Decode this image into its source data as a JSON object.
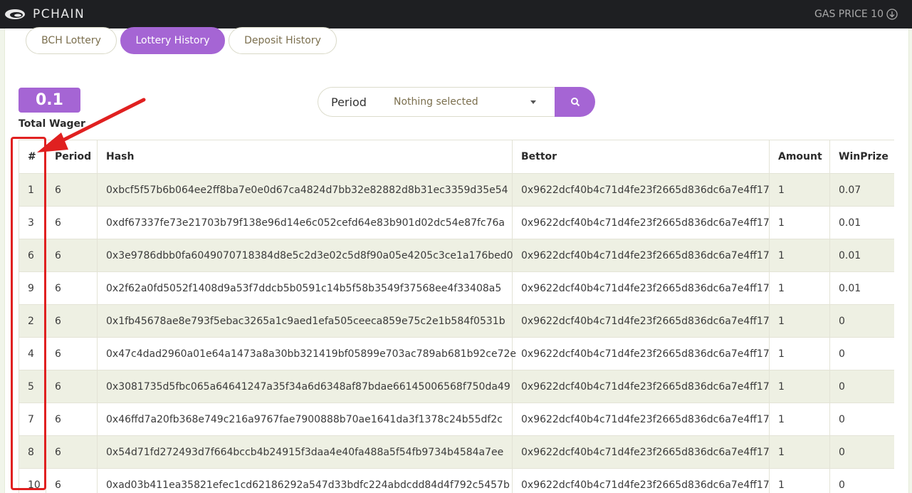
{
  "header": {
    "brand": "PCHAIN",
    "gas_label": "GAS PRICE 10"
  },
  "tabs": [
    {
      "label": "BCH Lottery",
      "active": false
    },
    {
      "label": "Lottery History",
      "active": true
    },
    {
      "label": "Deposit History",
      "active": false
    }
  ],
  "wager": {
    "value": "0.1",
    "label": "Total Wager"
  },
  "search": {
    "label": "Period",
    "selected": "Nothing selected"
  },
  "table": {
    "columns": [
      "#",
      "Period",
      "Hash",
      "Bettor",
      "Amount",
      "WinPrize"
    ],
    "rows": [
      [
        "1",
        "6",
        "0xbcf5f57b6b064ee2ff8ba7e0e0d67ca4824d7bb32e82882d8b31ec3359d35e54",
        "0x9622dcf40b4c71d4fe23f2665d836dc6a7e4ff17",
        "1",
        "0.07"
      ],
      [
        "3",
        "6",
        "0xdf67337fe73e21703b79f138e96d14e6c052cefd64e83b901d02dc54e87fc76a",
        "0x9622dcf40b4c71d4fe23f2665d836dc6a7e4ff17",
        "1",
        "0.01"
      ],
      [
        "6",
        "6",
        "0x3e9786dbb0fa6049070718384d8e5c2d3e02c5d8f90a05e4205c3ce1a176bed0",
        "0x9622dcf40b4c71d4fe23f2665d836dc6a7e4ff17",
        "1",
        "0.01"
      ],
      [
        "9",
        "6",
        "0x2f62a0fd5052f1408d9a53f7ddcb5b0591c14b5f58b3549f37568ee4f33408a5",
        "0x9622dcf40b4c71d4fe23f2665d836dc6a7e4ff17",
        "1",
        "0.01"
      ],
      [
        "2",
        "6",
        "0x1fb45678ae8e793f5ebac3265a1c9aed1efa505ceeca859e75c2e1b584f0531b",
        "0x9622dcf40b4c71d4fe23f2665d836dc6a7e4ff17",
        "1",
        "0"
      ],
      [
        "4",
        "6",
        "0x47c4dad2960a01e64a1473a8a30bb321419bf05899e703ac789ab681b92ce72e",
        "0x9622dcf40b4c71d4fe23f2665d836dc6a7e4ff17",
        "1",
        "0"
      ],
      [
        "5",
        "6",
        "0x3081735d5fbc065a64641247a35f34a6d6348af87bdae66145006568f750da49",
        "0x9622dcf40b4c71d4fe23f2665d836dc6a7e4ff17",
        "1",
        "0"
      ],
      [
        "7",
        "6",
        "0x46ffd7a20fb368e749c216a9767fae7900888b70ae1641da3f1378c24b55df2c",
        "0x9622dcf40b4c71d4fe23f2665d836dc6a7e4ff17",
        "1",
        "0"
      ],
      [
        "8",
        "6",
        "0x54d71fd272493d7f664bccb4b24915f3daa4e40fa488a5f54fb9734b4584a7ee",
        "0x9622dcf40b4c71d4fe23f2665d836dc6a7e4ff17",
        "1",
        "0"
      ],
      [
        "10",
        "6",
        "0xad03b411ea35821efec1cd62186292a547d33bdfc224abdcdd84d4f792c5457b",
        "0x9622dcf40b4c71d4fe23f2665d836dc6a7e4ff17",
        "1",
        "0"
      ]
    ]
  },
  "colors": {
    "accent": "#a565d4",
    "annotation": "#e02020",
    "row_shade": "#eef0e3"
  }
}
